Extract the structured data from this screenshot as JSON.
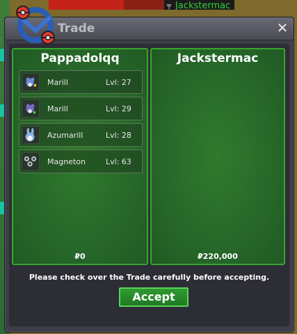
{
  "window": {
    "title": "Trade",
    "close_label": "✕"
  },
  "background": {
    "player_name": "Jackstermac"
  },
  "left_trader": {
    "name": "Pappadolqq",
    "money": "₽0",
    "pokemon": [
      {
        "name": "Marill",
        "level": "Lvl: 27",
        "icon": "marill-icon"
      },
      {
        "name": "Marill",
        "level": "Lvl: 29",
        "icon": "marill-icon"
      },
      {
        "name": "Azumarill",
        "level": "Lvl: 28",
        "icon": "azumarill-icon"
      },
      {
        "name": "Magneton",
        "level": "Lvl: 63",
        "icon": "magneton-icon"
      }
    ]
  },
  "right_trader": {
    "name": "Jackstermac",
    "money": "₽220,000",
    "pokemon": []
  },
  "footer": {
    "notice": "Please check over the Trade carefully before accepting.",
    "accept_label": "Accept"
  },
  "colors": {
    "panel_green": "#28692a",
    "panel_border": "#3aa52f",
    "window_bg": "#3d3e48",
    "accept_border": "#5bd35b"
  }
}
